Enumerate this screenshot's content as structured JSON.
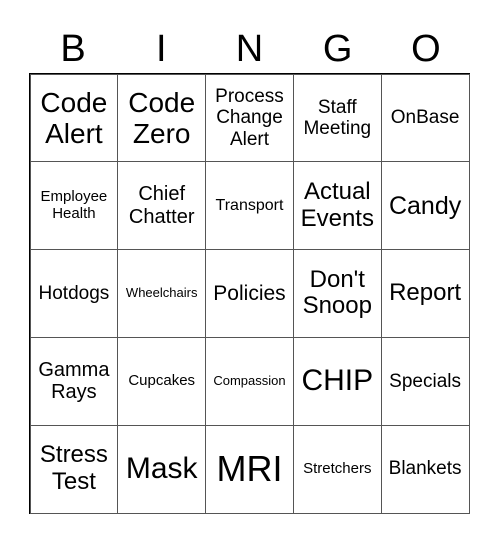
{
  "header": [
    "B",
    "I",
    "N",
    "G",
    "O"
  ],
  "cells": [
    {
      "text": "Code Alert",
      "size": 28
    },
    {
      "text": "Code Zero",
      "size": 28
    },
    {
      "text": "Process Change Alert",
      "size": 19
    },
    {
      "text": "Staff Meeting",
      "size": 19
    },
    {
      "text": "OnBase",
      "size": 19
    },
    {
      "text": "Employee Health",
      "size": 15
    },
    {
      "text": "Chief Chatter",
      "size": 20
    },
    {
      "text": "Transport",
      "size": 16
    },
    {
      "text": "Actual Events",
      "size": 24
    },
    {
      "text": "Candy",
      "size": 25
    },
    {
      "text": "Hotdogs",
      "size": 19
    },
    {
      "text": "Wheelchairs",
      "size": 13
    },
    {
      "text": "Policies",
      "size": 21
    },
    {
      "text": "Don't Snoop",
      "size": 24
    },
    {
      "text": "Report",
      "size": 24
    },
    {
      "text": "Gamma Rays",
      "size": 20
    },
    {
      "text": "Cupcakes",
      "size": 15
    },
    {
      "text": "Compassion",
      "size": 13
    },
    {
      "text": "CHIP",
      "size": 30
    },
    {
      "text": "Specials",
      "size": 19
    },
    {
      "text": "Stress Test",
      "size": 24
    },
    {
      "text": "Mask",
      "size": 30
    },
    {
      "text": "MRI",
      "size": 36
    },
    {
      "text": "Stretchers",
      "size": 15
    },
    {
      "text": "Blankets",
      "size": 19
    }
  ]
}
